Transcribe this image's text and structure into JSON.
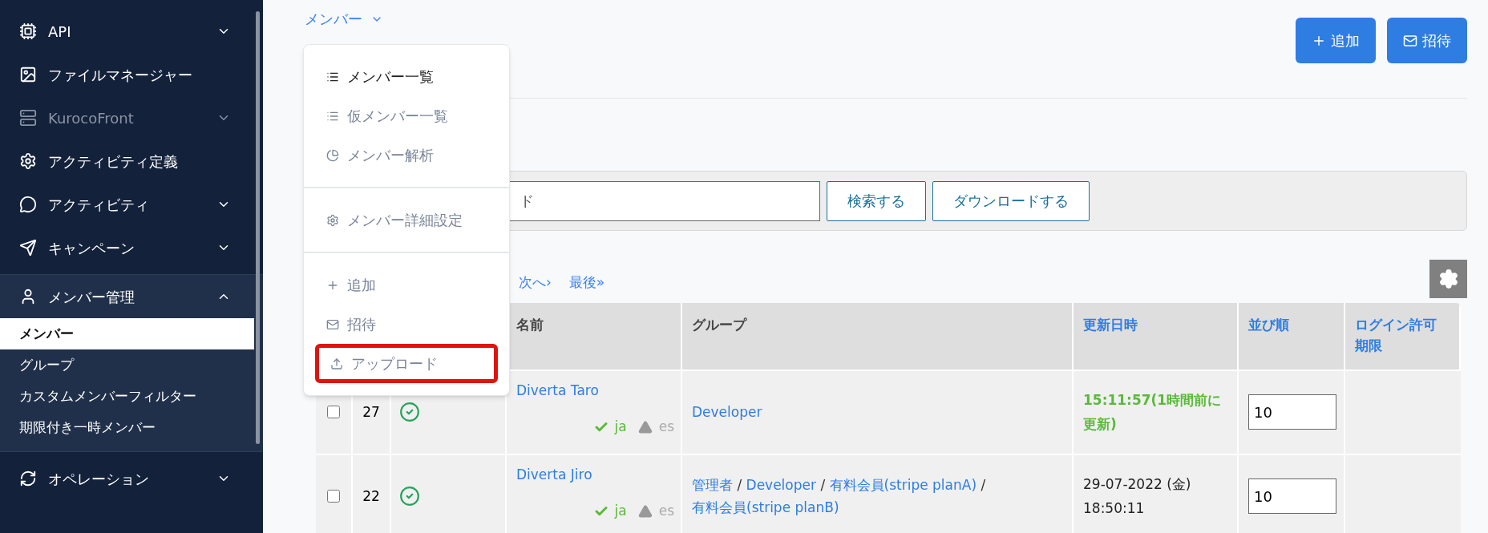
{
  "sidebar": {
    "items": [
      {
        "label": "API",
        "expandable": true,
        "expanded": false,
        "disabled": false
      },
      {
        "label": "ファイルマネージャー",
        "expandable": false,
        "expanded": false,
        "disabled": false
      },
      {
        "label": "KurocoFront",
        "expandable": true,
        "expanded": false,
        "disabled": true
      },
      {
        "label": "アクティビティ定義",
        "expandable": false,
        "expanded": false,
        "disabled": false
      },
      {
        "label": "アクティビティ",
        "expandable": true,
        "expanded": false,
        "disabled": false
      },
      {
        "label": "キャンペーン",
        "expandable": true,
        "expanded": false,
        "disabled": false
      },
      {
        "label": "メンバー管理",
        "expandable": true,
        "expanded": true,
        "disabled": false,
        "children": [
          {
            "label": "メンバー",
            "selected": true
          },
          {
            "label": "グループ",
            "selected": false
          },
          {
            "label": "カスタムメンバーフィルター",
            "selected": false
          },
          {
            "label": "期限付き一時メンバー",
            "selected": false
          }
        ]
      },
      {
        "label": "オペレーション",
        "expandable": true,
        "expanded": false,
        "disabled": false
      }
    ]
  },
  "breadcrumb": {
    "label": "メンバー"
  },
  "header_buttons": [
    {
      "label": "追加",
      "kind": "add"
    },
    {
      "label": "招待",
      "kind": "invite"
    }
  ],
  "menu": {
    "sections": [
      [
        {
          "label": "メンバー一覧",
          "kind": "list",
          "active": true,
          "highlighted": false
        },
        {
          "label": "仮メンバー一覧",
          "kind": "list",
          "active": false,
          "highlighted": false
        },
        {
          "label": "メンバー解析",
          "kind": "chart",
          "active": false,
          "highlighted": false
        }
      ],
      [
        {
          "label": "メンバー詳細設定",
          "kind": "settings",
          "active": false,
          "highlighted": false
        }
      ],
      [
        {
          "label": "追加",
          "kind": "add",
          "active": false,
          "highlighted": false
        },
        {
          "label": "招待",
          "kind": "invite",
          "active": false,
          "highlighted": false
        },
        {
          "label": "アップロード",
          "kind": "upload",
          "active": false,
          "highlighted": true
        }
      ]
    ]
  },
  "search": {
    "placeholder": "ド",
    "buttons": [
      "検索する",
      "ダウンロードする"
    ]
  },
  "pagination": [
    "次へ›",
    "最後»"
  ],
  "table": {
    "columns": [
      {
        "label": "名前",
        "sortable": false
      },
      {
        "label": "グループ",
        "sortable": false
      },
      {
        "label": "更新日時",
        "sortable": true
      },
      {
        "label": "並び順",
        "sortable": true
      },
      {
        "label": "ログイン許可期限",
        "sortable": true
      }
    ],
    "rows": [
      {
        "checked": false,
        "id": "27",
        "name": "Diverta Taro",
        "langs": [
          {
            "label": "ja",
            "kind": "ok"
          },
          {
            "label": "es",
            "kind": "warn"
          }
        ],
        "groups": [
          {
            "label": "Developer",
            "kind": "link"
          }
        ],
        "updated": "15:11:57(1時間前に更新)",
        "recent": true,
        "order": "10"
      },
      {
        "checked": false,
        "id": "22",
        "name": "Diverta Jiro",
        "langs": [
          {
            "label": "ja",
            "kind": "ok"
          },
          {
            "label": "es",
            "kind": "warn"
          }
        ],
        "groups": [
          {
            "label": "管理者",
            "kind": "link"
          },
          {
            "label": "/",
            "kind": "separator"
          },
          {
            "label": "Developer",
            "kind": "link"
          },
          {
            "label": "/",
            "kind": "separator"
          },
          {
            "label": "有料会員(stripe planA)",
            "kind": "link"
          },
          {
            "label": "/",
            "kind": "separator"
          },
          {
            "label": "有料会員(stripe planB)",
            "kind": "link"
          }
        ],
        "updated": "29-07-2022 (金) 18:50:11",
        "recent": false,
        "order": "10"
      }
    ]
  }
}
